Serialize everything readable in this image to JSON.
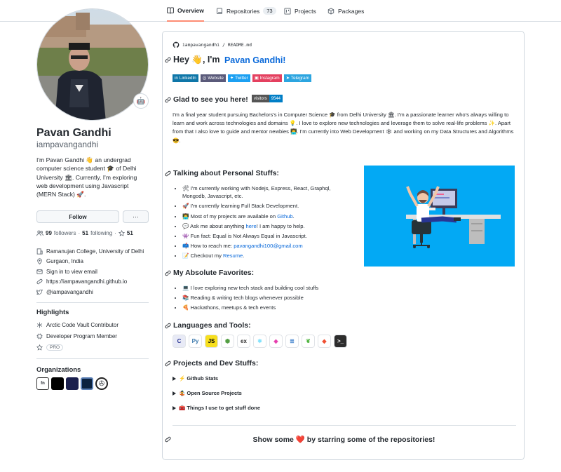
{
  "tabs": [
    {
      "label": "Overview",
      "active": true
    },
    {
      "label": "Repositories",
      "count": "73"
    },
    {
      "label": "Projects"
    },
    {
      "label": "Packages"
    }
  ],
  "profile": {
    "name": "Pavan Gandhi",
    "login": "iampavangandhi",
    "status_emoji": "🤖",
    "bio": "I'm Pavan Gandhi 👋 an undergrad computer science student 🎓 of Delhi University 🏛. Currently, I'm exploring web development using Javascript (MERN Stack) 🚀.",
    "follow_label": "Follow",
    "more_label": "···",
    "followers_count": "99",
    "followers_label": "followers",
    "following_count": "51",
    "following_label": "following",
    "stars_count": "51",
    "separator": "·",
    "vcard": {
      "org": "Ramanujan College, University of Delhi",
      "location": "Gurgaon, India",
      "email": "Sign in to view email",
      "website": "https://iampavangandhi.github.io",
      "twitter": "@iampavangandhi"
    }
  },
  "highlights": {
    "title": "Highlights",
    "items": [
      "Arctic Code Vault Contributor",
      "Developer Program Member",
      "PRO"
    ]
  },
  "organizations": {
    "title": "Organizations"
  },
  "readme": {
    "path_user": "iampavangandhi",
    "path_sep": "/",
    "path_file": "README.md",
    "hey_prefix": "Hey 👋, I'm ",
    "hey_name": "Pavan Gandhi!",
    "badges": [
      {
        "label": "LinkedIn",
        "color": "#0e76a8"
      },
      {
        "label": "Website",
        "color": "#5a5a7a"
      },
      {
        "label": "Twitter",
        "color": "#1ca0f2"
      },
      {
        "label": "Instagram",
        "color": "#e4405f"
      },
      {
        "label": "Telegram",
        "color": "#2ca5e0"
      }
    ],
    "glad_heading": "Glad to see you here!",
    "visitors_label": "visitors",
    "visitors_count": "9544",
    "intro": "I'm a final year student pursuing Bachelors's in Computer Science 🎓 from Delhi University 🏛. I'm a passionate learner who's always willing to learn and work across technologies and domains 💡. I love to explore new technologies and leverage them to solve real-life problems ✨. Apart from that I also love to guide and mentor newbies 👨‍💻. I'm currently into Web Development 🕸 and working on my Data Structures and Algorithms 😎.",
    "personal_heading": "Talking about Personal Stuffs:",
    "personal": [
      {
        "text": "🛠  I'm currently working with Nodejs, Express, React, Graphql, Mongodb, Javascript, etc."
      },
      {
        "text": "🚀  I'm currently learning Full Stack Development."
      },
      {
        "text": "👨‍💻  Most of my projects are available on ",
        "link": "Github",
        "after": "."
      },
      {
        "text": "💬  Ask me about anything ",
        "link": "here",
        "after": "! I am happy to help."
      },
      {
        "text": "👾  Fun fact: Equal is Not Always Equal in Javascript."
      },
      {
        "text": "📫  How to reach me: ",
        "link": "pavangandhi100@gmail.com",
        "after": ""
      },
      {
        "text": "📝  Checkout my ",
        "link": "Resume",
        "after": "."
      }
    ],
    "favorites_heading": "My Absolute Favorites:",
    "favorites": [
      "💻  I love exploring new tech stack and building cool stuffs",
      "📚  Reading & writing tech blogs whenever possible",
      "🍕  Hackathons, meetups & tech events"
    ],
    "languages_heading": "Languages and Tools:",
    "tools": [
      {
        "name": "c-icon",
        "glyph": "C",
        "bg": "#e8eaf6",
        "fg": "#283593"
      },
      {
        "name": "python-icon",
        "glyph": "Py",
        "bg": "#ffffff",
        "fg": "#3776ab"
      },
      {
        "name": "javascript-icon",
        "glyph": "JS",
        "bg": "#f7df1e",
        "fg": "#000000"
      },
      {
        "name": "nodejs-icon",
        "glyph": "⬢",
        "bg": "#ffffff",
        "fg": "#539e43"
      },
      {
        "name": "express-icon",
        "glyph": "ex",
        "bg": "#ffffff",
        "fg": "#333333"
      },
      {
        "name": "react-icon",
        "glyph": "⚛",
        "bg": "#ffffff",
        "fg": "#61dafb"
      },
      {
        "name": "graphql-icon",
        "glyph": "◈",
        "bg": "#ffffff",
        "fg": "#e535ab"
      },
      {
        "name": "sql-icon",
        "glyph": "≣",
        "bg": "#ffffff",
        "fg": "#1565c0"
      },
      {
        "name": "mongodb-icon",
        "glyph": "❦",
        "bg": "#ffffff",
        "fg": "#4db33d"
      },
      {
        "name": "git-icon",
        "glyph": "◆",
        "bg": "#ffffff",
        "fg": "#f05033"
      },
      {
        "name": "terminal-icon",
        "glyph": ">_",
        "bg": "#2d2d2d",
        "fg": "#ffffff"
      }
    ],
    "projects_heading": "Projects and Dev Stuffs:",
    "details": [
      "⚡ Github Stats",
      "🤹 Open Source Projects",
      "🧰 Things I use to get stuff done"
    ],
    "footer_pre": "Show some ",
    "footer_heart": "❤️",
    "footer_post": " by starring some of the repositories!"
  }
}
